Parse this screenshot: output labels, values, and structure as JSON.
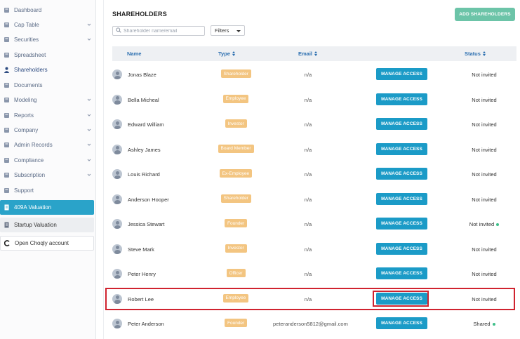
{
  "sidebar": {
    "items": [
      {
        "label": "Dashboard",
        "icon": "dashboard-icon",
        "chevron": false
      },
      {
        "label": "Cap Table",
        "icon": "cap-table-icon",
        "chevron": true
      },
      {
        "label": "Securities",
        "icon": "securities-icon",
        "chevron": true
      },
      {
        "label": "Spreadsheet",
        "icon": "spreadsheet-icon",
        "chevron": false
      },
      {
        "label": "Shareholders",
        "icon": "person-icon",
        "chevron": false
      },
      {
        "label": "Documents",
        "icon": "documents-icon",
        "chevron": false
      },
      {
        "label": "Modeling",
        "icon": "modeling-icon",
        "chevron": true
      },
      {
        "label": "Reports",
        "icon": "reports-icon",
        "chevron": true
      },
      {
        "label": "Company",
        "icon": "company-icon",
        "chevron": true
      },
      {
        "label": "Admin Records",
        "icon": "admin-records-icon",
        "chevron": true
      },
      {
        "label": "Compliance",
        "icon": "compliance-icon",
        "chevron": true
      },
      {
        "label": "Subscription",
        "icon": "subscription-icon",
        "chevron": true
      },
      {
        "label": "Support",
        "icon": "support-icon",
        "chevron": false
      }
    ],
    "valuation_409a": "409A Valuation",
    "startup_valuation": "Startup Valuation",
    "open_account": "Open Choqly account"
  },
  "header": {
    "title": "SHAREHOLDERS",
    "add_button": "ADD SHAREHOLDERS"
  },
  "search": {
    "placeholder": "Shareholder name/email"
  },
  "filters": {
    "label": "Filters"
  },
  "table": {
    "columns": {
      "name": "Name",
      "type": "Type",
      "email": "Email",
      "status": "Status"
    },
    "manage_label": "MANAGE ACCESS",
    "rows": [
      {
        "name": "Jonas Blaze",
        "type": "Shareholder",
        "email": "n/a",
        "status": "Not invited"
      },
      {
        "name": "Bella Micheal",
        "type": "Employee",
        "email": "n/a",
        "status": "Not invited"
      },
      {
        "name": "Edward William",
        "type": "Investor",
        "email": "n/a",
        "status": "Not invited"
      },
      {
        "name": "Ashley James",
        "type": "Board Member",
        "email": "n/a",
        "status": "Not invited"
      },
      {
        "name": "Louis Richard",
        "type": "Ex-Employee",
        "email": "n/a",
        "status": "Not invited"
      },
      {
        "name": "Anderson Hooper",
        "type": "Shareholder",
        "email": "n/a",
        "status": "Not invited"
      },
      {
        "name": "Jessica Stewart",
        "type": "Founder",
        "email": "n/a",
        "status": "Not invited",
        "status_dot": true
      },
      {
        "name": "Steve Mark",
        "type": "Investor",
        "email": "n/a",
        "status": "Not invited"
      },
      {
        "name": "Peter Henry",
        "type": "Officer",
        "email": "n/a",
        "status": "Not invited"
      },
      {
        "name": "Robert Lee",
        "type": "Employee",
        "email": "n/a",
        "status": "Not invited",
        "highlighted": true
      },
      {
        "name": "Peter Anderson",
        "type": "Founder",
        "email": "peteranderson5812@gmail.com",
        "status": "Shared",
        "status_dot": true
      }
    ]
  },
  "colors": {
    "accent": "#1b9bc7",
    "add_button": "#6cc4a8",
    "type_badge": "#f3c581",
    "highlight": "#d0232f",
    "status_dot": "#3fbf8a"
  }
}
